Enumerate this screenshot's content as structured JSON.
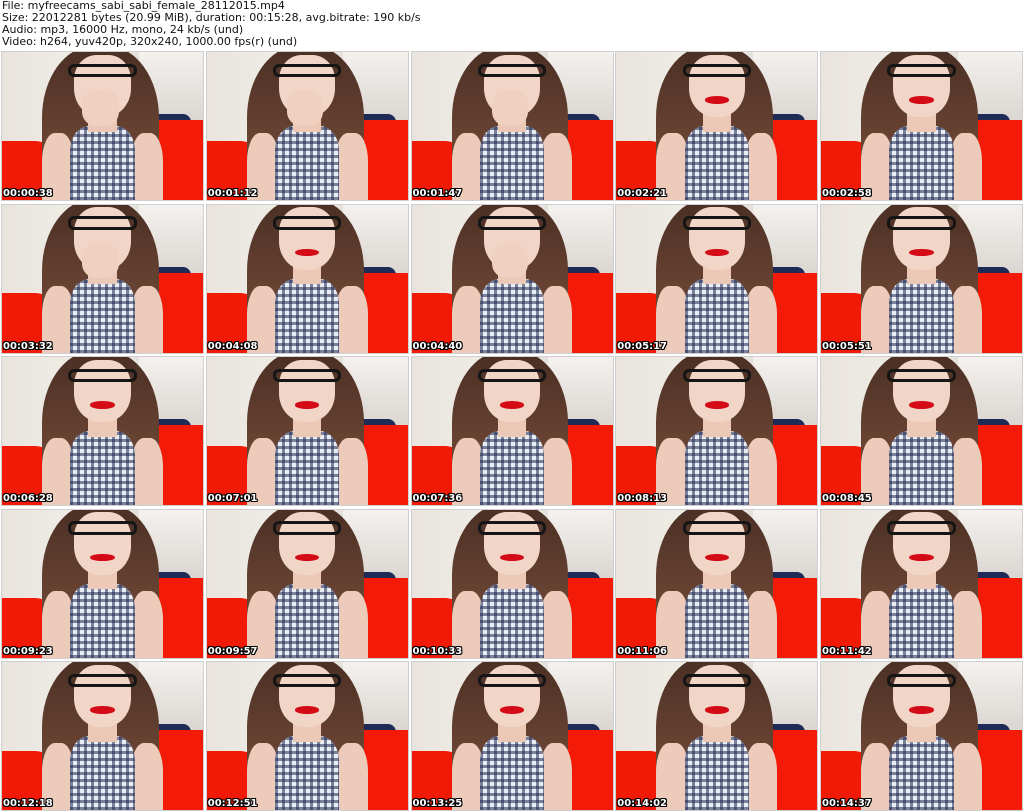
{
  "header": {
    "file": "File: myfreecams_sabi_sabi_female_28112015.mp4",
    "size": "Size: 22012281 bytes (20.99 MiB), duration: 00:15:28, avg.bitrate: 190 kb/s",
    "audio": "Audio: mp3, 16000 Hz, mono, 24 kb/s (und)",
    "video": "Video: h264, yuv420p, 320x240, 1000.00 fps(r) (und)"
  },
  "thumbnails": [
    {
      "time": "00:00:38",
      "hand": true
    },
    {
      "time": "00:01:12",
      "hand": true
    },
    {
      "time": "00:01:47",
      "hand": true
    },
    {
      "time": "00:02:21",
      "hand": false
    },
    {
      "time": "00:02:58",
      "hand": false
    },
    {
      "time": "00:03:32",
      "hand": true
    },
    {
      "time": "00:04:08",
      "hand": false
    },
    {
      "time": "00:04:40",
      "hand": true
    },
    {
      "time": "00:05:17",
      "hand": false
    },
    {
      "time": "00:05:51",
      "hand": false
    },
    {
      "time": "00:06:28",
      "hand": false
    },
    {
      "time": "00:07:01",
      "hand": false
    },
    {
      "time": "00:07:36",
      "hand": false
    },
    {
      "time": "00:08:13",
      "hand": false
    },
    {
      "time": "00:08:45",
      "hand": false
    },
    {
      "time": "00:09:23",
      "hand": false
    },
    {
      "time": "00:09:57",
      "hand": false
    },
    {
      "time": "00:10:33",
      "hand": false
    },
    {
      "time": "00:11:06",
      "hand": false
    },
    {
      "time": "00:11:42",
      "hand": false
    },
    {
      "time": "00:12:18",
      "hand": false
    },
    {
      "time": "00:12:51",
      "hand": false
    },
    {
      "time": "00:13:25",
      "hand": false
    },
    {
      "time": "00:14:02",
      "hand": false
    },
    {
      "time": "00:14:37",
      "hand": false
    }
  ],
  "colors": {
    "couch": "#f31b08",
    "pillow": "#1d2b56",
    "lips": "#d40b17",
    "hair": "#5b3a2b"
  }
}
